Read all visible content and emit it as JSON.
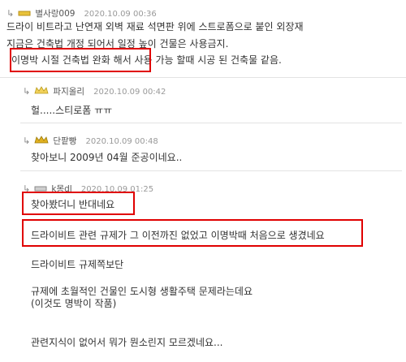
{
  "comments": [
    {
      "nick": "별사랑009",
      "date": "2020.10.09 00:36",
      "lines": [
        "드라이 비트라고 난연재 외벽 재료 석면판 위에 스트로폼으로 붙인 외장재",
        "지금은 건축법 개정 되어서 일정 높이 건물은 사용금지.",
        "이명박 시절 건축법 완화 해서 사용 가능 할때 시공 된 건축물 같음."
      ],
      "level_icon": "gold-bar-level-icon"
    },
    {
      "nick": "파지올리",
      "date": "2020.10.09 00:42",
      "lines": [
        "헐.....스티로폼 ㅠㅠ"
      ],
      "level_icon": "crown-level-icon"
    },
    {
      "nick": "단팥빵",
      "date": "2020.10.09 00:48",
      "lines": [
        "찾아보니 2009년 04월 준공이네요.."
      ],
      "level_icon": "gold-crown-level-icon"
    },
    {
      "nick": "k몽dl",
      "date": "2020.10.09 01:25",
      "lines": [
        "찾아봤더니 반대네요",
        "드라이비트 관련 규제가 그 이전까진 없었고 이명박때 처음으로 생겼네요",
        "드라이비트 규제쪽보단",
        "규제에 초월적인 건물인 도시형 생활주택 문제라는데요",
        "(이것도 명박이 작품)",
        "관련지식이 없어서 뭐가 뭔소린지 모르겠네요..."
      ],
      "level_icon": "gray-bar-level-icon"
    }
  ],
  "colors": {
    "highlight_box": "#e00000",
    "meta_text": "#999999",
    "body_text": "#333333",
    "separator": "#e3e3e3"
  }
}
